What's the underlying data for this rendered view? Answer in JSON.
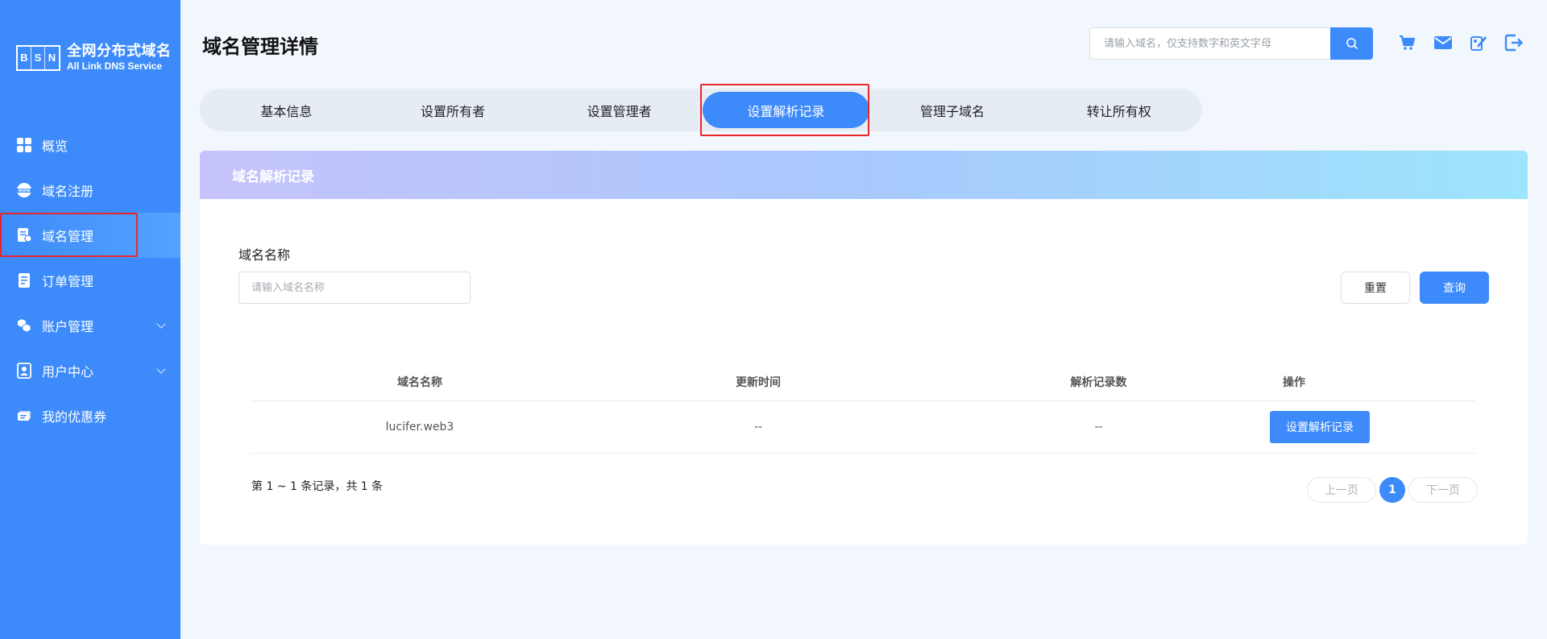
{
  "logo": {
    "letters": [
      "B",
      "S",
      "N"
    ],
    "title_cn": "全网分布式域名",
    "title_en": "All Link DNS Service"
  },
  "sidebar": {
    "items": [
      {
        "label": "概览",
        "icon": "grid-icon"
      },
      {
        "label": "域名注册",
        "icon": "www-icon"
      },
      {
        "label": "域名管理",
        "icon": "domain-doc-icon"
      },
      {
        "label": "订单管理",
        "icon": "order-icon"
      },
      {
        "label": "账户管理",
        "icon": "cubes-icon"
      },
      {
        "label": "用户中心",
        "icon": "user-icon"
      },
      {
        "label": "我的优惠券",
        "icon": "coupon-icon"
      }
    ]
  },
  "header": {
    "title": "域名管理详情",
    "search_placeholder": "请输入域名，仅支持数字和英文字母"
  },
  "tabs": [
    "基本信息",
    "设置所有者",
    "设置管理者",
    "设置解析记录",
    "管理子域名",
    "转让所有权"
  ],
  "card": {
    "title": "域名解析记录",
    "field_label": "域名名称",
    "field_placeholder": "请输入域名名称",
    "reset_label": "重置",
    "query_label": "查询"
  },
  "table": {
    "headers": [
      "域名名称",
      "更新时间",
      "解析记录数",
      "操作"
    ],
    "rows": [
      {
        "name": "lucifer.web3",
        "updated": "--",
        "records": "--",
        "action": "设置解析记录"
      }
    ]
  },
  "pagination": {
    "total_text": "第 1 ~ 1 条记录，共 1 条",
    "prev": "上一页",
    "current": "1",
    "next": "下一页"
  },
  "colors": {
    "primary": "#3d8bfa",
    "highlight": "#e8262a"
  }
}
